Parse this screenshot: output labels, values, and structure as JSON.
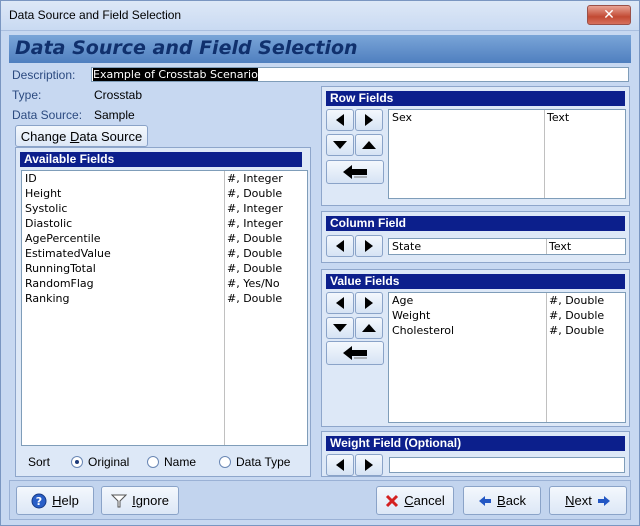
{
  "window": {
    "title": "Data Source and Field Selection"
  },
  "heading": "Data Source and Field Selection",
  "description": {
    "label": "Description:",
    "value": "Example of Crosstab Scenario"
  },
  "type": {
    "label": "Type:",
    "value": "Crosstab"
  },
  "data_source": {
    "label": "Data Source:",
    "value": "Sample"
  },
  "change_button": {
    "pre": "Change ",
    "accel": "D",
    "post": "ata Source"
  },
  "available_fields": {
    "title": "Available Fields",
    "items": [
      {
        "name": "ID",
        "type": "#, Integer"
      },
      {
        "name": "Height",
        "type": "#, Double"
      },
      {
        "name": "Systolic",
        "type": "#, Integer"
      },
      {
        "name": "Diastolic",
        "type": "#, Integer"
      },
      {
        "name": "AgePercentile",
        "type": "#, Double"
      },
      {
        "name": "EstimatedValue",
        "type": "#, Double"
      },
      {
        "name": "RunningTotal",
        "type": "#, Double"
      },
      {
        "name": "RandomFlag",
        "type": "#, Yes/No"
      },
      {
        "name": "Ranking",
        "type": "#, Double"
      }
    ]
  },
  "sort": {
    "label": "Sort",
    "options": [
      "Original",
      "Name",
      "Data Type"
    ],
    "selected": "Original"
  },
  "row_fields": {
    "title": "Row Fields",
    "items": [
      {
        "name": "Sex",
        "type": "Text"
      }
    ]
  },
  "column_field": {
    "title": "Column Field",
    "item": {
      "name": "State",
      "type": "Text"
    }
  },
  "value_fields": {
    "title": "Value Fields",
    "items": [
      {
        "name": "Age",
        "type": "#, Double"
      },
      {
        "name": "Weight",
        "type": "#, Double"
      },
      {
        "name": "Cholesterol",
        "type": "#, Double"
      }
    ]
  },
  "weight_field": {
    "title": "Weight Field (Optional)",
    "value": ""
  },
  "footer": {
    "help": {
      "accel": "H",
      "rest": "elp"
    },
    "ignore": {
      "accel": "I",
      "rest": "gnore"
    },
    "cancel": {
      "accel": "C",
      "rest": "ancel"
    },
    "back": {
      "accel": "B",
      "rest": "ack"
    },
    "next": {
      "accel": "N",
      "rest": "ext"
    }
  },
  "colors": {
    "panel_header": "#0c1f8c",
    "heading_text": "#10306d",
    "cancel_icon": "#d42020",
    "arrow_icon": "#2357c4"
  }
}
